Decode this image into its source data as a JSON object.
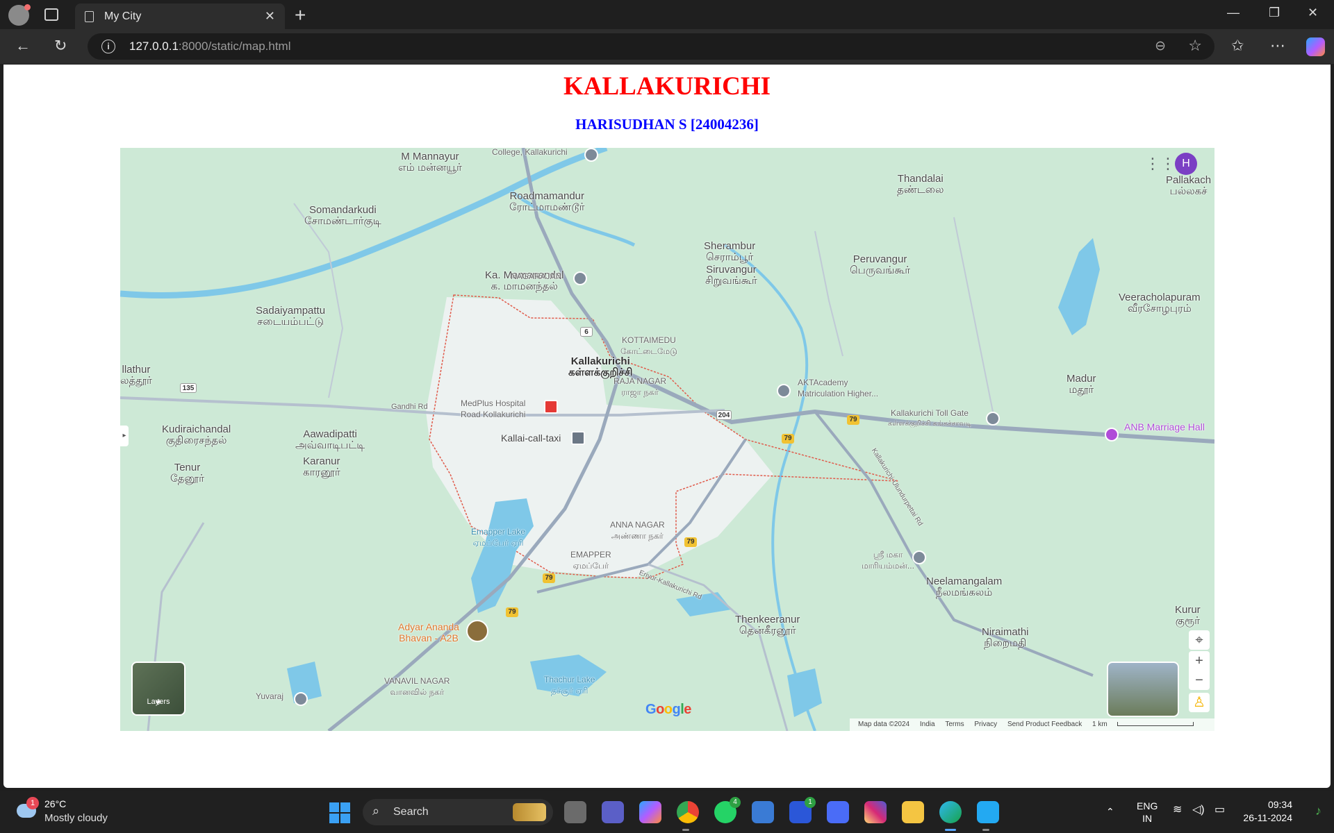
{
  "browser": {
    "tab_title": "My City",
    "url_host": "127.0.0.1",
    "url_rest": ":8000/static/map.html",
    "icons": [
      "profile-icon",
      "tab-actions-icon",
      "page-icon",
      "close-icon",
      "new-tab-icon",
      "minimize-icon",
      "restore-icon",
      "window-close-icon",
      "back-icon",
      "reload-icon",
      "info-icon",
      "zoom-icon",
      "favorite-icon",
      "favorites-icon",
      "more-icon",
      "copilot-icon"
    ]
  },
  "page": {
    "title": "KALLAKURICHI",
    "subtitle": "HARISUDHAN S [24004236]",
    "title_color": "#ff0000",
    "subtitle_color": "#0000ff"
  },
  "map": {
    "places": [
      {
        "en": "M Mannayur",
        "ta": "எம் மன்னயூர்"
      },
      {
        "en": "Roadmamandur",
        "ta": "ரோட்மாமண்டூர்"
      },
      {
        "en": "Somandarkudi",
        "ta": "சோமண்டார்குடி"
      },
      {
        "en": "Thandalai",
        "ta": "தண்டலை"
      },
      {
        "en": "Pallakach",
        "ta": "பல்லகச்"
      },
      {
        "en": "Sherambur",
        "ta": "செராம்பூர்"
      },
      {
        "en": "Siruvangur",
        "ta": "சிறுவங்கூர்"
      },
      {
        "en": "Peruvangur",
        "ta": "பெருவங்கூர்"
      },
      {
        "en": "Sadaiyampattu",
        "ta": "சடையம்பட்டு"
      },
      {
        "en": "Ka. Mamanandal",
        "ta": "க. மாமனந்தல்"
      },
      {
        "en": "Veeracholapuram",
        "ta": "வீரசோழபுரம்"
      },
      {
        "en": "KOTTAIMEDU",
        "ta": "கோட்டைமேடு"
      },
      {
        "en": "Kallakurichi",
        "ta": "கள்ளக்குறிச்சி"
      },
      {
        "en": "RAJA NAGAR",
        "ta": "ராஜா நகர்"
      },
      {
        "en": "Madur",
        "ta": "மதூர்"
      },
      {
        "en": "llathur",
        "ta": "லத்தூர்"
      },
      {
        "en": "Kudiraichandal",
        "ta": "குதிரைசந்தல்"
      },
      {
        "en": "Aawadipatti",
        "ta": "அவ்வாடிபட்டி"
      },
      {
        "en": "Tenur",
        "ta": "தேனூர்"
      },
      {
        "en": "Karanur",
        "ta": "காரனூர்"
      },
      {
        "en": "ANNA NAGAR",
        "ta": "அண்ணா நகர்"
      },
      {
        "en": "EMAPPER",
        "ta": "ஏமப்பேர்"
      },
      {
        "en": "Neelamangalam",
        "ta": "நீலமங்கலம்"
      },
      {
        "en": "Thenkeeranur",
        "ta": "தென்கீரனூர்"
      },
      {
        "en": "Niraimathi",
        "ta": "நிறைமதி"
      },
      {
        "en": "Kurur",
        "ta": "குரூர்"
      },
      {
        "en": "VANAVIL NAGAR",
        "ta": "வானவில் நகர்"
      }
    ],
    "water": [
      {
        "en": "Emapper Lake",
        "ta": "ஏமப்பேர் ஏரி"
      },
      {
        "en": "Thachur Lake",
        "ta": "தச்சூர் ஏரி"
      }
    ],
    "pois": {
      "college": "College, Kallakurichi",
      "nagarajan": "NAGARAJAN",
      "medplus_1": "MedPlus Hospital",
      "medplus_2": "Road Kollakurichi",
      "taxi": "Kallai-call-taxi",
      "akt_1": "AKTAcademy",
      "akt_2": "Matriculation Higher...",
      "toll": "Kallakurichi Toll Gate",
      "toll_ta": "கள்ளக்குறிச்சி சுங்கச்சாவடி",
      "anb": "ANB Marriage Hall",
      "adyar_1": "Adyar Ananda",
      "adyar_2": "Bhavan - A2B",
      "yuvaraj": "Yuvaraj",
      "sri": "ஸ்ரீ மகா மாரியம்மன்..."
    },
    "roads": {
      "gandhi": "Gandhi Rd",
      "kallakurichi_rd": "Kallakurichi-Ulundurpettai Rd",
      "eriyur": "Eriyur-Kallakurichi Rd",
      "r135": "135",
      "r6": "6",
      "r204": "204",
      "r79": "79"
    },
    "controls": {
      "layers": "Layers",
      "avatar": "H",
      "google": "Google"
    },
    "attribution": {
      "map_data": "Map data ©2024",
      "india": "India",
      "terms": "Terms",
      "privacy": "Privacy",
      "feedback": "Send Product Feedback",
      "scale": "1 km"
    },
    "colors": {
      "land": "#cde9d6",
      "water": "#7fc8e8",
      "city": "#f1f3f4",
      "road": "#9aa9bc",
      "boundary": "#e05a4a"
    }
  },
  "taskbar": {
    "weather_temp": "26°C",
    "weather_cond": "Mostly cloudy",
    "weather_badge": "1",
    "search_label": "Search",
    "whatsapp_badge": "4",
    "l_badge": "1",
    "lang_1": "ENG",
    "lang_2": "IN",
    "time": "09:34",
    "date": "26-11-2024",
    "apps": [
      "start-icon",
      "task-view-icon",
      "teams-icon",
      "copilot-icon",
      "chrome-icon",
      "whatsapp-icon",
      "store-icon",
      "l-app-icon",
      "arc-icon",
      "instagram-icon",
      "file-explorer-icon",
      "edge-icon",
      "vscode-icon"
    ]
  }
}
